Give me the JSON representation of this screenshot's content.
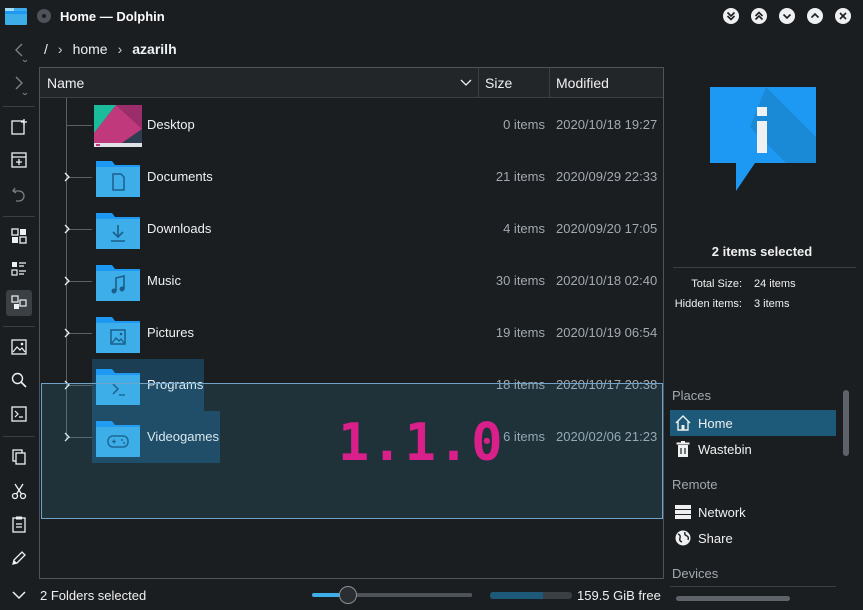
{
  "window": {
    "title": "Home — Dolphin"
  },
  "breadcrumb": {
    "root": "/",
    "items": [
      "home",
      "azarilh"
    ]
  },
  "columns": {
    "name": "Name",
    "size": "Size",
    "modified": "Modified"
  },
  "files": [
    {
      "name": "Desktop",
      "size": "0 items",
      "modified": "2020/10/18 19:27",
      "icon": "desktop-thumbnail-icon",
      "expandable": false,
      "selected": false
    },
    {
      "name": "Documents",
      "size": "21 items",
      "modified": "2020/09/29 22:33",
      "icon": "folder-documents-icon",
      "expandable": true,
      "selected": false
    },
    {
      "name": "Downloads",
      "size": "4 items",
      "modified": "2020/09/20 17:05",
      "icon": "folder-download-icon",
      "expandable": true,
      "selected": false
    },
    {
      "name": "Music",
      "size": "30 items",
      "modified": "2020/10/18 02:40",
      "icon": "folder-music-icon",
      "expandable": true,
      "selected": false
    },
    {
      "name": "Pictures",
      "size": "19 items",
      "modified": "2020/10/19 06:54",
      "icon": "folder-pictures-icon",
      "expandable": true,
      "selected": false
    },
    {
      "name": "Programs",
      "size": "18 items",
      "modified": "2020/10/17 20:38",
      "icon": "folder-terminal-icon",
      "expandable": true,
      "selected": true
    },
    {
      "name": "Videogames",
      "size": "6 items",
      "modified": "2020/02/06 21:23",
      "icon": "folder-games-icon",
      "expandable": true,
      "selected": true
    }
  ],
  "overlay": {
    "version": "1.1.0",
    "version_color": "#d81f8a"
  },
  "info_panel": {
    "title": "2 items selected",
    "total_size_label": "Total Size:",
    "total_size_value": "24 items",
    "hidden_label": "Hidden items:",
    "hidden_value": "3 items"
  },
  "places": {
    "places_header": "Places",
    "home": "Home",
    "wastebin": "Wastebin",
    "remote_header": "Remote",
    "network": "Network",
    "share": "Share",
    "devices_header": "Devices"
  },
  "status": {
    "text": "2 Folders selected",
    "zoom_fraction": 0.23,
    "space_used_fraction": 0.65,
    "free_space": "159.5 GiB free"
  },
  "colors": {
    "accent": "#3daee9",
    "folder": "#3daee9",
    "selection": "#1d5978",
    "background": "#1b1e20"
  }
}
